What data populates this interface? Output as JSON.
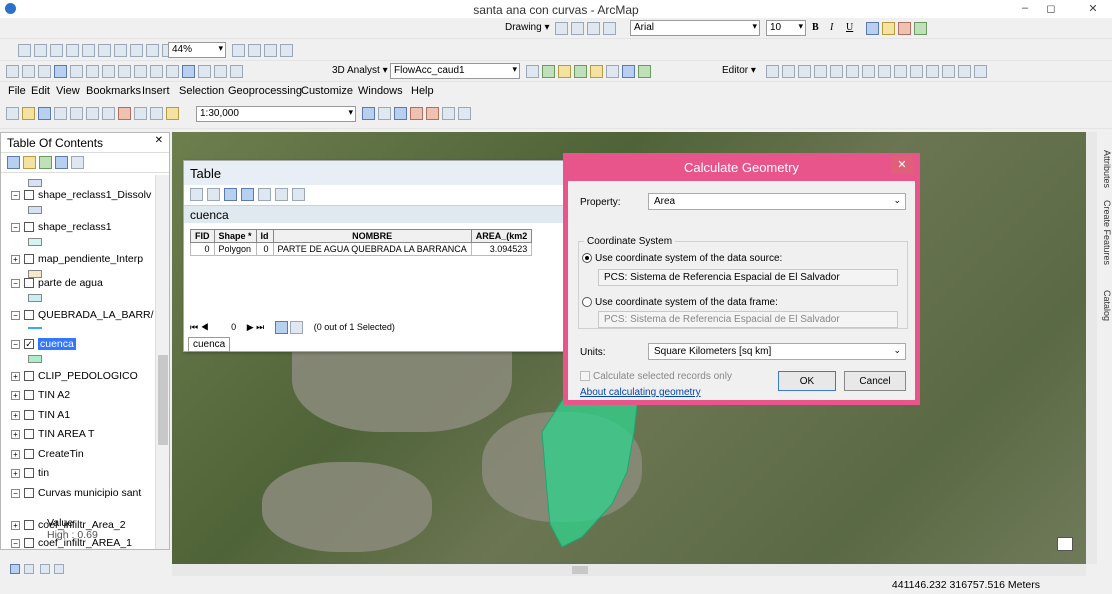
{
  "window": {
    "title": "santa ana con curvas - ArcMap",
    "min": "–",
    "max": "◻",
    "close": "✕"
  },
  "toolbars": {
    "drawing": "Drawing ▾",
    "font": "Arial",
    "font_size": "10",
    "bold": "B",
    "italic": "I",
    "underline": "U",
    "zoom_pct": "44%",
    "analyst": "3D Analyst ▾",
    "layer": "FlowAcc_caud1",
    "editor": "Editor ▾",
    "scale": "1:30,000"
  },
  "menu": [
    "File",
    "Edit",
    "View",
    "Bookmarks",
    "Insert",
    "Selection",
    "Geoprocessing",
    "Customize",
    "Windows",
    "Help"
  ],
  "toc": {
    "title": "Table Of Contents",
    "close": "✕",
    "items": [
      {
        "label": "shape_reclass1_Dissolv",
        "exp": "⊟",
        "checked": false,
        "swatch": "#d6e0f6"
      },
      {
        "label": "shape_reclass1",
        "exp": "⊟",
        "checked": false,
        "swatch": "#d4f4f2"
      },
      {
        "label": "map_pendiente_Interp",
        "exp": "⊞",
        "checked": false,
        "swatch": "#f6e8c8"
      },
      {
        "label": "parte de agua",
        "exp": "⊟",
        "checked": false,
        "swatch": "#c8f0f4"
      },
      {
        "label": "QUEBRADA_LA_BARR/",
        "exp": "⊟",
        "checked": false,
        "swatch": ""
      },
      {
        "label": "cuenca",
        "exp": "⊟",
        "checked": true,
        "swatch": "#a8f0c8"
      },
      {
        "label": "CLIP_PEDOLOGICO",
        "exp": "⊞",
        "checked": false,
        "swatch": ""
      },
      {
        "label": "TIN A2",
        "exp": "⊞",
        "checked": false,
        "swatch": ""
      },
      {
        "label": "TIN A1",
        "exp": "⊞",
        "checked": false,
        "swatch": ""
      },
      {
        "label": "TIN AREA T",
        "exp": "⊞",
        "checked": false,
        "swatch": ""
      },
      {
        "label": "CreateTin",
        "exp": "⊞",
        "checked": false,
        "swatch": ""
      },
      {
        "label": "tin",
        "exp": "⊞",
        "checked": false,
        "swatch": ""
      },
      {
        "label": "Curvas municipio sant",
        "exp": "⊟",
        "checked": false,
        "swatch": ""
      },
      {
        "label": "coef_infiltr_Area_2",
        "exp": "⊞",
        "checked": false,
        "swatch": ""
      },
      {
        "label": "coef_infiltr_AREA_1",
        "exp": "⊟",
        "checked": false,
        "swatch": ""
      }
    ],
    "value_label": "Value",
    "high_label": "High : 0.69"
  },
  "table": {
    "title": "Table",
    "layer_name": "cuenca",
    "columns": [
      "FID",
      "Shape *",
      "Id",
      "NOMBRE",
      "AREA_(km2"
    ],
    "rows": [
      [
        "0",
        "Polygon",
        "0",
        "PARTE DE AGUA QUEBRADA LA BARRANCA",
        "3.094523"
      ]
    ],
    "nav_record": "0",
    "selection": "(0 out of 1 Selected)",
    "tab": "cuenca"
  },
  "dialog": {
    "title": "Calculate Geometry",
    "property_label": "Property:",
    "property_value": "Area",
    "cs_label": "Coordinate System",
    "opt1": "Use coordinate system of the data source:",
    "opt1_value": "PCS: Sistema de Referencia Espacial de El Salvador",
    "opt2": "Use coordinate system of the data frame:",
    "opt2_value": "PCS: Sistema de Referencia Espacial de El Salvador",
    "units_label": "Units:",
    "units_value": "Square Kilometers [sq km]",
    "selected_only": "Calculate selected records only",
    "about": "About calculating geometry",
    "ok": "OK",
    "cancel": "Cancel"
  },
  "side_tabs": [
    "Attributes",
    "Create Features",
    "Catalog"
  ],
  "status": {
    "coords": "441146.232  316757.516 Meters"
  },
  "colors": {
    "dialog_border": "#e8558a",
    "polygon": "#2fd48e"
  }
}
